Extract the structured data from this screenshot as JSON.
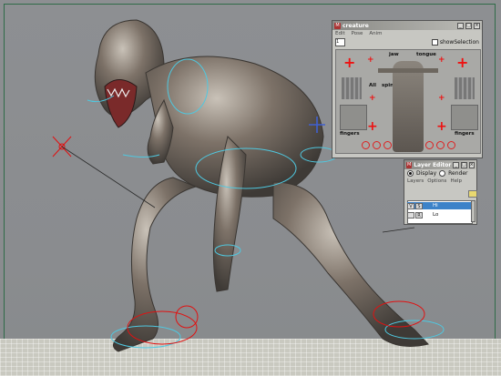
{
  "creature_window": {
    "title": "creature",
    "menus": [
      "Edit",
      "Pose",
      "Anim"
    ],
    "selector_value": "1",
    "checkbox_label": "showSelection",
    "labels": {
      "jaw": "jaw",
      "tongue": "tongue",
      "all": "All",
      "spine": "spine",
      "fingers_left": "fingers",
      "fingers_right": "fingers"
    }
  },
  "layer_window": {
    "title": "Layer Editor",
    "radio_display": "Display",
    "radio_render": "Render",
    "menus": [
      "Layers",
      "Options",
      "Help"
    ],
    "layers": [
      {
        "v": "V",
        "r": "S",
        "name": "Hi"
      },
      {
        "v": "",
        "r": "R",
        "name": "Lo"
      }
    ]
  },
  "colors": {
    "control_red": "#e11111",
    "rig_cyan": "#4fc8e0",
    "frame_green": "#2f6b48"
  }
}
